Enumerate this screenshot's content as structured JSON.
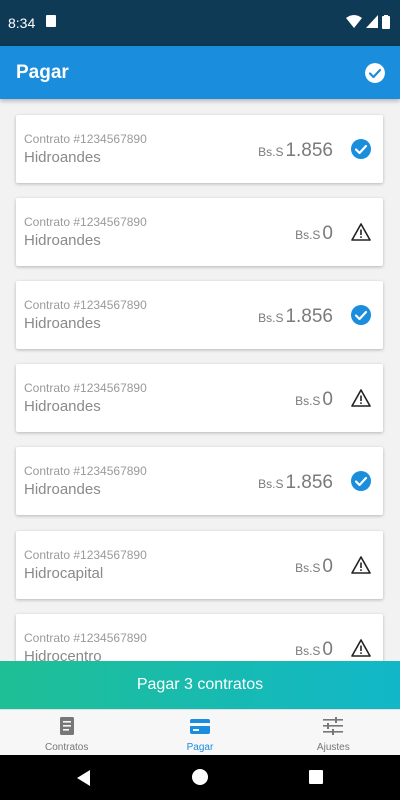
{
  "status_bar": {
    "time": "8:34",
    "icons": [
      "sd-card-icon",
      "wifi-icon",
      "signal-icon",
      "battery-icon"
    ]
  },
  "app_bar": {
    "title": "Pagar",
    "action_icon": "check-circle-icon"
  },
  "contracts": [
    {
      "number": "Contrato #1234567890",
      "company": "Hidroandes",
      "currency": "Bs.S",
      "amount": "1.856",
      "status": "selected"
    },
    {
      "number": "Contrato #1234567890",
      "company": "Hidroandes",
      "currency": "Bs.S",
      "amount": "0",
      "status": "warning"
    },
    {
      "number": "Contrato #1234567890",
      "company": "Hidroandes",
      "currency": "Bs.S",
      "amount": "1.856",
      "status": "selected"
    },
    {
      "number": "Contrato #1234567890",
      "company": "Hidroandes",
      "currency": "Bs.S",
      "amount": "0",
      "status": "warning"
    },
    {
      "number": "Contrato #1234567890",
      "company": "Hidroandes",
      "currency": "Bs.S",
      "amount": "1.856",
      "status": "selected"
    },
    {
      "number": "Contrato #1234567890",
      "company": "Hidrocapital",
      "currency": "Bs.S",
      "amount": "0",
      "status": "warning"
    },
    {
      "number": "Contrato #1234567890",
      "company": "Hidrocentro",
      "currency": "Bs.S",
      "amount": "0",
      "status": "warning"
    }
  ],
  "pay_button": {
    "label": "Pagar 3 contratos"
  },
  "bottom_nav": {
    "items": [
      {
        "label": "Contratos",
        "icon": "document-icon",
        "active": false
      },
      {
        "label": "Pagar",
        "icon": "card-icon",
        "active": true
      },
      {
        "label": "Ajustes",
        "icon": "sliders-icon",
        "active": false
      }
    ]
  },
  "system_nav": {
    "icons": [
      "back-icon",
      "home-icon",
      "recents-icon"
    ]
  },
  "colors": {
    "status_bar": "#0e3a56",
    "app_bar": "#1a8ddd",
    "pay_gradient_start": "#1fbf95",
    "pay_gradient_end": "#11b7c8",
    "check": "#1a8ddd"
  }
}
